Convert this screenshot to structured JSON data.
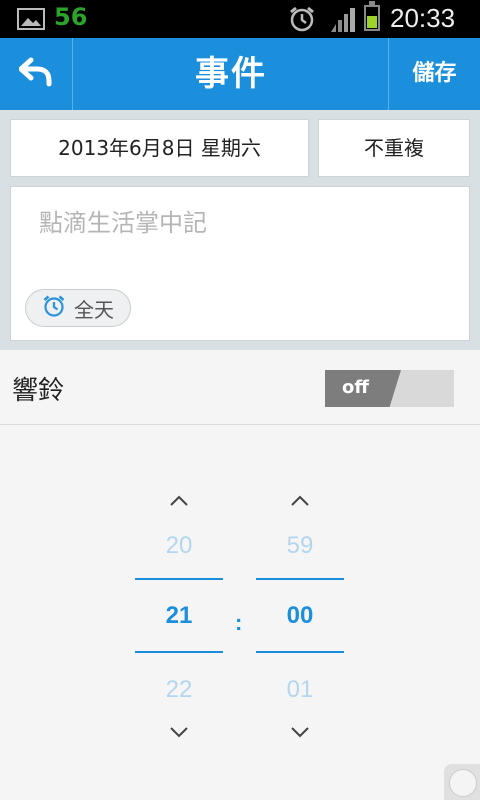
{
  "status_bar": {
    "notification_count": "56",
    "time": "20:33",
    "icons": [
      "picture-icon",
      "alarm-icon",
      "signal-icon",
      "battery-icon"
    ]
  },
  "header": {
    "title": "事件",
    "save_label": "儲存",
    "back_icon": "back-arrow-icon",
    "color": "#1b8fdc"
  },
  "event": {
    "date": "2013年6月8日 星期六",
    "repeat": "不重複",
    "note_placeholder": "點滴生活掌中記",
    "all_day_label": "全天"
  },
  "alarm": {
    "label": "響鈴",
    "toggle_state": "off"
  },
  "time_picker": {
    "hour": {
      "prev": "20",
      "current": "21",
      "next": "22"
    },
    "minute": {
      "prev": "59",
      "current": "00",
      "next": "01"
    },
    "separator": ":"
  }
}
